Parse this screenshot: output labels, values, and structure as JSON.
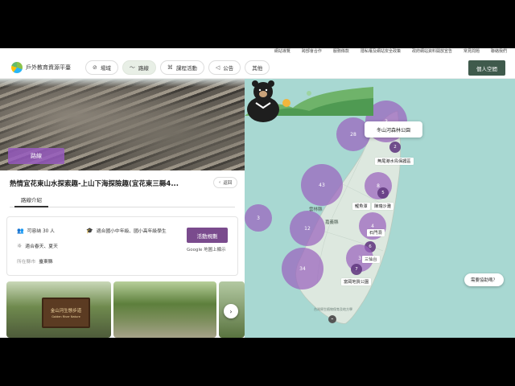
{
  "util_links": [
    "網站導覽",
    "跨部會合作",
    "服務條款",
    "隱私權及網站安全政策",
    "政府網站資料開放宣告",
    "常見問題",
    "聯絡我們"
  ],
  "header": {
    "logo_text": "戶外教育資源平臺",
    "nav": [
      {
        "label": "場域",
        "icon": "compass-icon"
      },
      {
        "label": "路線",
        "icon": "route-icon"
      },
      {
        "label": "課程活動",
        "icon": "activity-icon"
      },
      {
        "label": "公告",
        "icon": "megaphone-icon"
      },
      {
        "label": "其他",
        "icon": ""
      }
    ],
    "account_label": "個人空間"
  },
  "route": {
    "tag": "路線",
    "title": "熱情宜花東山水探索趣-上山下海探險趣(宜花東三縣4...",
    "back_label": "返回",
    "tab_label": "路線介紹",
    "info": {
      "capacity": "可容納 30 人",
      "grade": "適合國小中年級、國小高年級學生",
      "season": "適合春天、夏天",
      "location_label": "所在縣市",
      "location_value": "臺東縣",
      "activity_button": "活動規劃",
      "map_link": "Google 地圖上顯示"
    },
    "photo_sign": "金山河生態步道",
    "photo_sign_sub": "Golden River Nature"
  },
  "map": {
    "popup": "冬山河森林公園",
    "clusters": [
      "28",
      "2",
      "43",
      "8",
      "3",
      "5",
      "4",
      "6",
      "12",
      "34",
      "3",
      "7",
      "3"
    ],
    "labels": [
      "無尾港水鳥保護區",
      "鯉魚潭",
      "陳瑞沙灘",
      "石門洞",
      "三仙台",
      "富岡地質公園"
    ],
    "counties": [
      "雲林縣",
      "嘉義縣"
    ],
    "caption": "台灣原生植物保育及地方學",
    "bubble": "需要協助嗎？"
  },
  "colors": {
    "accent": "#7a4b8d",
    "cluster": "#9a62be",
    "header_button": "#3f5a4c",
    "sea": "#a8d8d2",
    "land": "#dde8df"
  }
}
